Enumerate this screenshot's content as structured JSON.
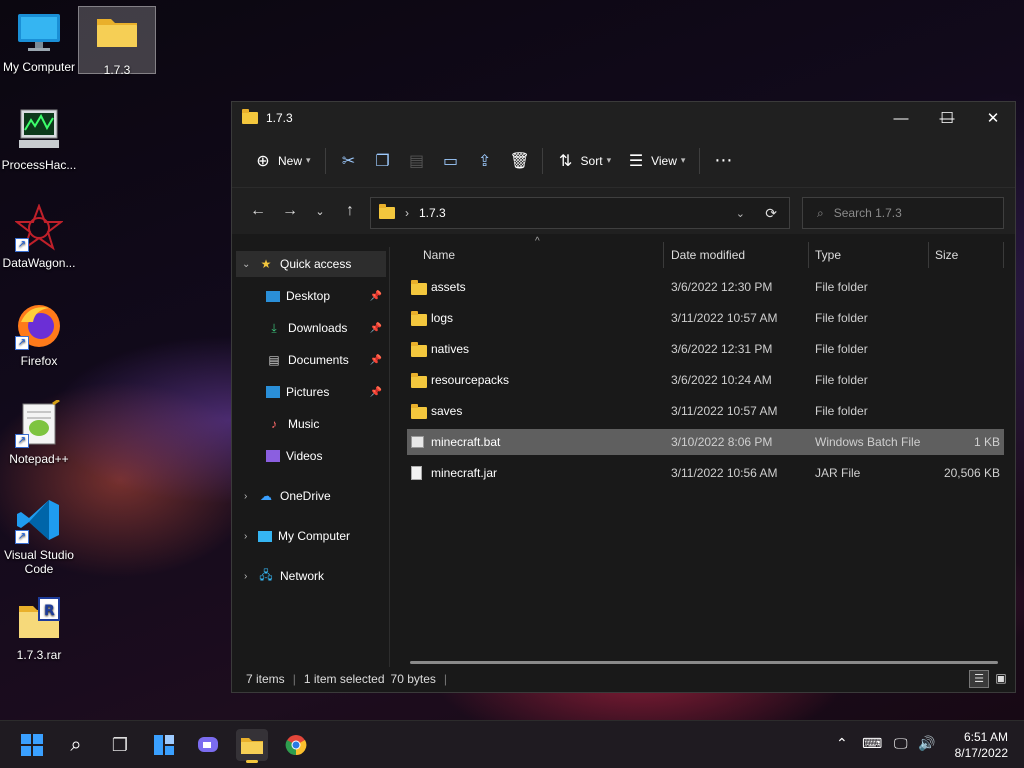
{
  "desktop": {
    "icons": [
      {
        "label": "My Computer"
      },
      {
        "label": "1.7.3"
      },
      {
        "label": "ProcessHac..."
      },
      {
        "label": "DataWagon..."
      },
      {
        "label": "Firefox"
      },
      {
        "label": "Notepad++"
      },
      {
        "label": "Visual Studio Code"
      },
      {
        "label": "1.7.3.rar"
      }
    ]
  },
  "window": {
    "title": "1.7.3",
    "toolbar": {
      "new_label": "New",
      "sort_label": "Sort",
      "view_label": "View"
    },
    "address": {
      "path": "1.7.3"
    },
    "search": {
      "placeholder": "Search 1.7.3"
    },
    "nav": {
      "quick_access": "Quick access",
      "pinned": [
        {
          "label": "Desktop"
        },
        {
          "label": "Downloads"
        },
        {
          "label": "Documents"
        },
        {
          "label": "Pictures"
        },
        {
          "label": "Music"
        },
        {
          "label": "Videos"
        }
      ],
      "onedrive": "OneDrive",
      "my_computer": "My Computer",
      "network": "Network"
    },
    "columns": {
      "name": "Name",
      "date": "Date modified",
      "type": "Type",
      "size": "Size"
    },
    "files": [
      {
        "name": "assets",
        "date": "3/6/2022 12:30 PM",
        "type": "File folder",
        "size": "",
        "kind": "folder"
      },
      {
        "name": "logs",
        "date": "3/11/2022 10:57 AM",
        "type": "File folder",
        "size": "",
        "kind": "folder"
      },
      {
        "name": "natives",
        "date": "3/6/2022 12:31 PM",
        "type": "File folder",
        "size": "",
        "kind": "folder"
      },
      {
        "name": "resourcepacks",
        "date": "3/6/2022 10:24 AM",
        "type": "File folder",
        "size": "",
        "kind": "folder"
      },
      {
        "name": "saves",
        "date": "3/11/2022 10:57 AM",
        "type": "File folder",
        "size": "",
        "kind": "folder"
      },
      {
        "name": "minecraft.bat",
        "date": "3/10/2022 8:06 PM",
        "type": "Windows Batch File",
        "size": "1 KB",
        "kind": "bat",
        "selected": true
      },
      {
        "name": "minecraft.jar",
        "date": "3/11/2022 10:56 AM",
        "type": "JAR File",
        "size": "20,506 KB",
        "kind": "file"
      }
    ],
    "status": {
      "items": "7 items",
      "selected": "1 item selected",
      "bytes": "70 bytes"
    }
  },
  "taskbar": {
    "clock_time": "6:51 AM",
    "clock_date": "8/17/2022"
  },
  "colors": {
    "accent": "#f3c73d",
    "selection": "#5f5f5f",
    "window_bg": "#191919"
  }
}
